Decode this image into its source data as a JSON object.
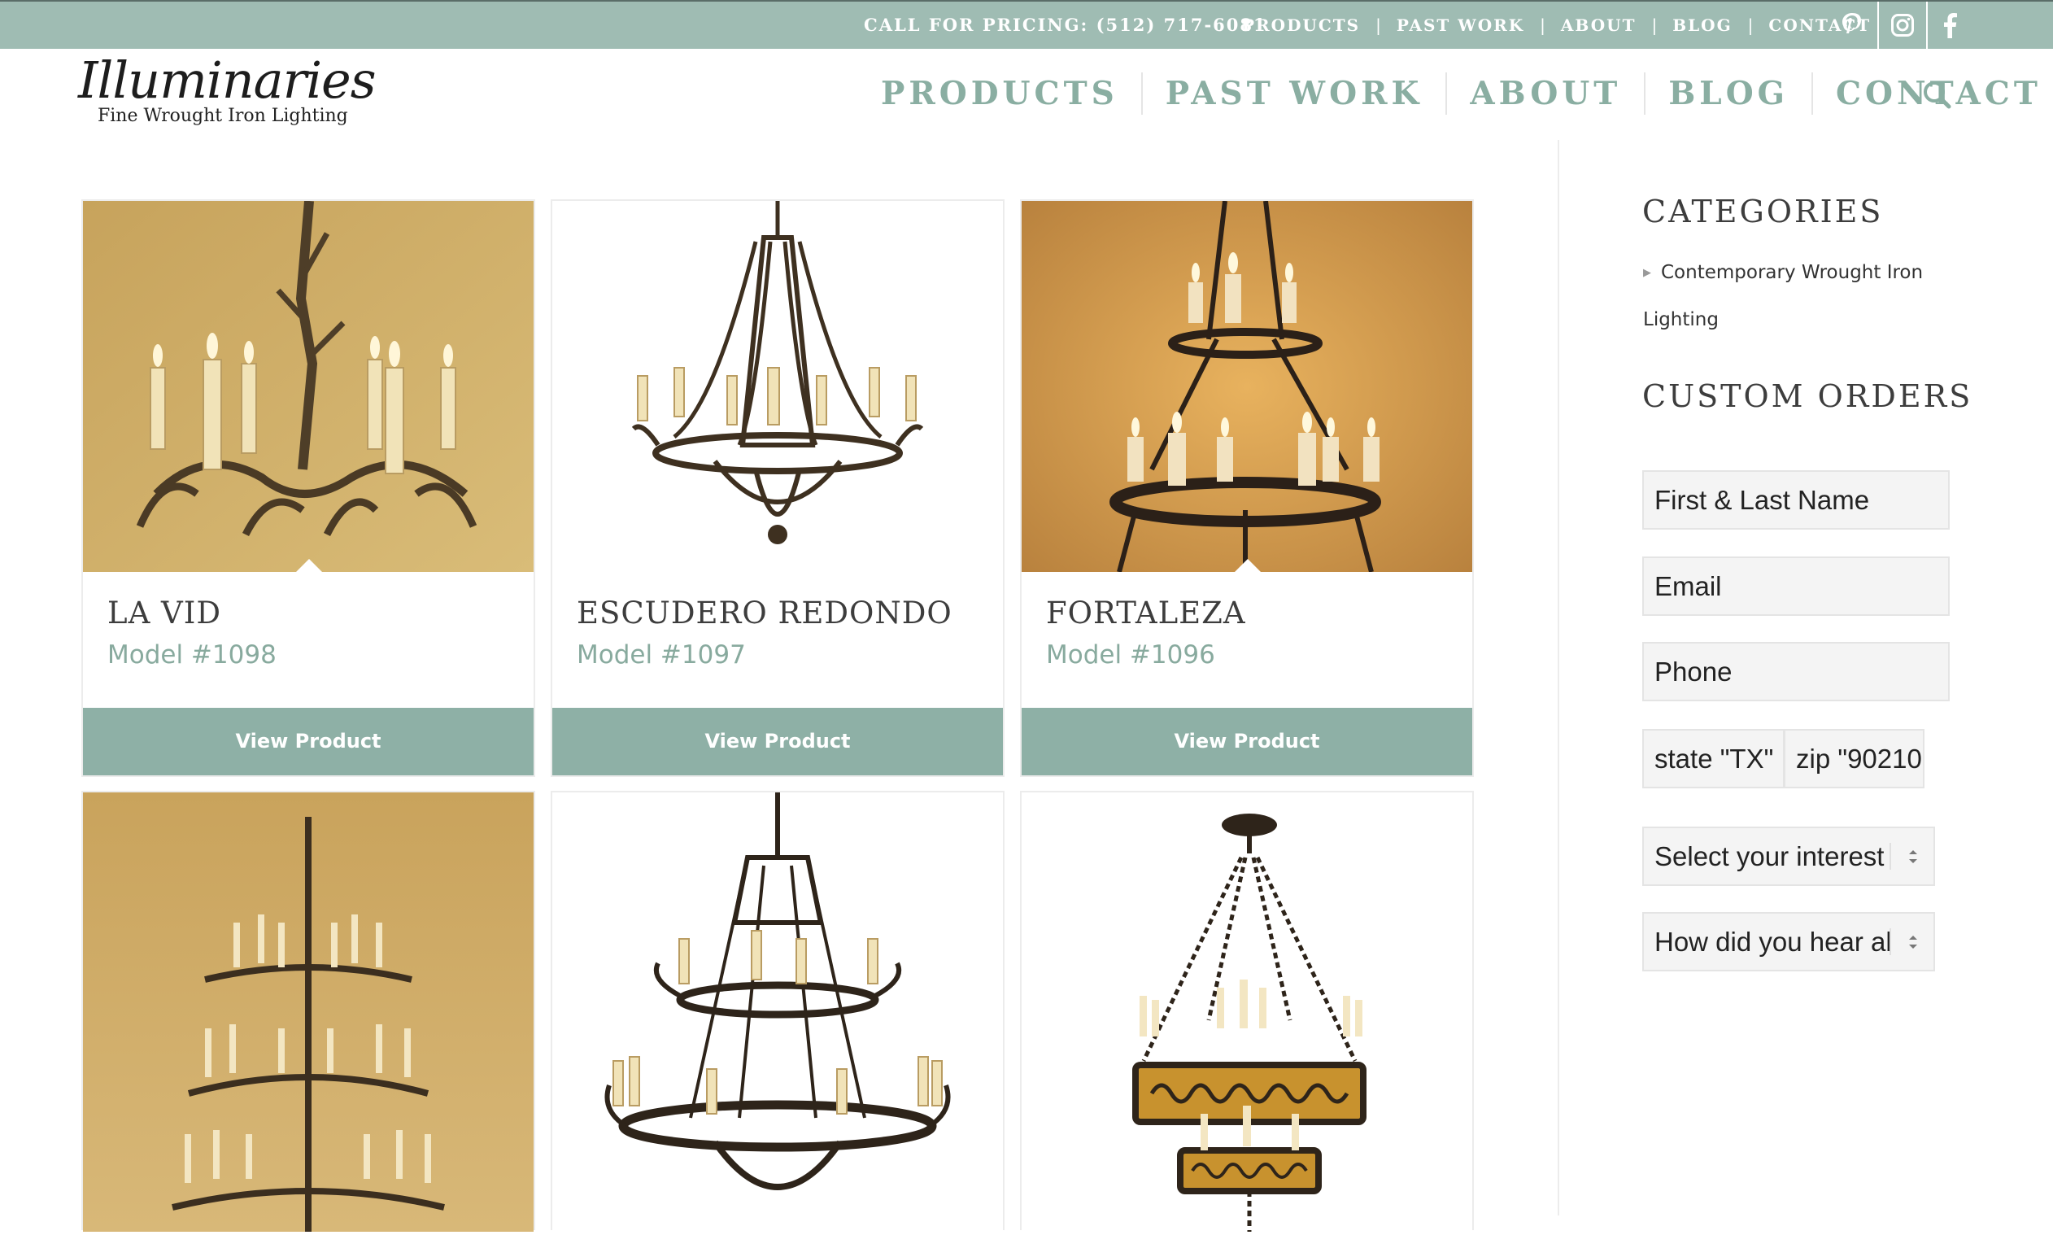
{
  "topbar": {
    "pricing": "CALL FOR PRICING: (512) 717-6081",
    "nav": [
      "PRODUCTS",
      "PAST WORK",
      "ABOUT",
      "BLOG",
      "CONTACT"
    ],
    "social": [
      "pinterest-icon",
      "instagram-icon",
      "facebook-icon"
    ]
  },
  "brand": {
    "name": "Illuminaries",
    "tagline": "Fine Wrought Iron Lighting"
  },
  "mainnav": [
    "PRODUCTS",
    "PAST WORK",
    "ABOUT",
    "BLOG",
    "CONTACT"
  ],
  "products": [
    {
      "name": "LA VID",
      "model": "Model #1098",
      "button": "View Product"
    },
    {
      "name": "ESCUDERO REDONDO",
      "model": "Model #1097",
      "button": "View Product"
    },
    {
      "name": "FORTALEZA",
      "model": "Model #1096",
      "button": "View Product"
    }
  ],
  "sidebar": {
    "categories_heading": "CATEGORIES",
    "category_link": "Contemporary Wrought Iron Lighting",
    "custom_heading": "CUSTOM ORDERS",
    "fields": {
      "name": "First & Last Name",
      "email": "Email",
      "phone": "Phone",
      "state": "state \"TX\"",
      "zip": "zip \"90210\"",
      "interest": "Select your interest",
      "hear": "How did you hear about us"
    }
  },
  "colors": {
    "accent": "#9fbcb3",
    "button": "#8eb0a6",
    "nav_text": "#8aaea2"
  }
}
